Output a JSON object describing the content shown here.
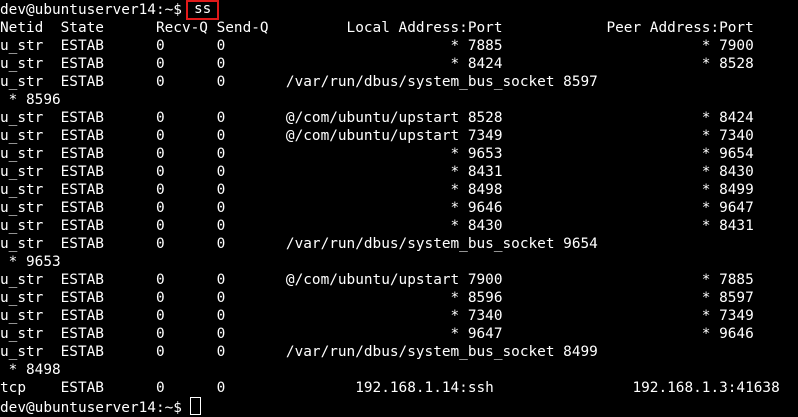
{
  "terminal": {
    "prompt": "dev@ubuntuserver14:~$",
    "command": "ss",
    "output_lines": [
      "Netid  State      Recv-Q Send-Q         Local Address:Port            Peer Address:Port",
      "u_str  ESTAB      0      0                          * 7885                       * 7900",
      "u_str  ESTAB      0      0                          * 8424                       * 8528",
      "u_str  ESTAB      0      0       /var/run/dbus/system_bus_socket 8597",
      " * 8596",
      "u_str  ESTAB      0      0       @/com/ubuntu/upstart 8528                       * 8424",
      "u_str  ESTAB      0      0       @/com/ubuntu/upstart 7349                       * 7340",
      "u_str  ESTAB      0      0                          * 9653                       * 9654",
      "u_str  ESTAB      0      0                          * 8431                       * 8430",
      "u_str  ESTAB      0      0                          * 8498                       * 8499",
      "u_str  ESTAB      0      0                          * 9646                       * 9647",
      "u_str  ESTAB      0      0                          * 8430                       * 8431",
      "u_str  ESTAB      0      0       /var/run/dbus/system_bus_socket 9654",
      " * 9653",
      "u_str  ESTAB      0      0       @/com/ubuntu/upstart 7900                       * 7885",
      "u_str  ESTAB      0      0                          * 8596                       * 8597",
      "u_str  ESTAB      0      0                          * 7340                       * 7349",
      "u_str  ESTAB      0      0                          * 9647                       * 9646",
      "u_str  ESTAB      0      0       /var/run/dbus/system_bus_socket 8499",
      " * 8498",
      "tcp    ESTAB      0      0               192.168.1.14:ssh                192.168.1.3:41638"
    ]
  },
  "colors": {
    "background": "#000000",
    "text": "#ffffff",
    "highlight_border": "#e11a1a"
  }
}
